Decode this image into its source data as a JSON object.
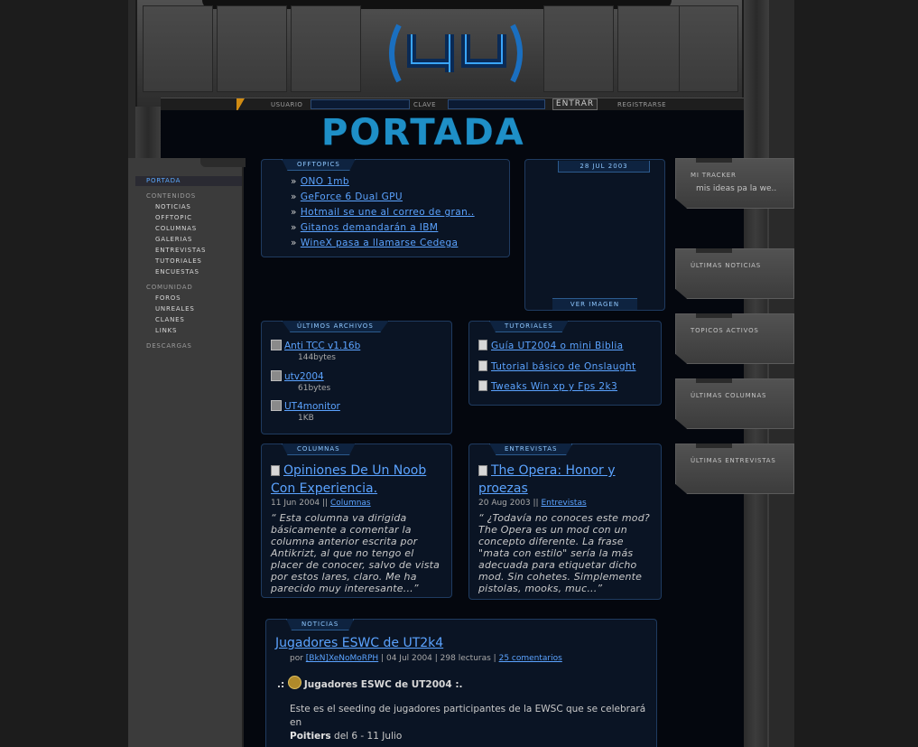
{
  "header": {
    "logo_text": "(4U)",
    "login": {
      "user_label": "USUARIO",
      "pass_label": "CLAVE",
      "enter_label": "ENTRAR",
      "register_label": "REGISTRARSE"
    }
  },
  "page_title": "PORTADA",
  "nav": {
    "portada": "PORTADA",
    "contenidos": "CONTENIDOS",
    "noticias": "NOTICIAS",
    "offtopic": "OFFTOPIC",
    "columnas": "COLUMNAS",
    "galerias": "GALERIAS",
    "entrevistas": "ENTREVISTAS",
    "tutoriales": "TUTORIALES",
    "encuestas": "ENCUESTAS",
    "comunidad": "COMUNIDAD",
    "foros": "FOROS",
    "unreales": "UNREALES",
    "clanes": "CLANES",
    "links": "LINKS",
    "descargas": "DESCARGAS"
  },
  "right": {
    "tracker_title": "Mi TRACKER",
    "tracker_text": "mis ideas pa la we..",
    "noticias": "ÚLTIMAS NOTICIAS",
    "topicos": "TOPICOS ACTIVOS",
    "columnas": "ÚLTIMAS COLUMNAS",
    "entrevistas": "ÚLTIMAS ENTREVISTAS"
  },
  "offtopics": {
    "title": "OFFTOPICS",
    "items": [
      "ONO 1mb",
      "GeForce 6 Dual GPU",
      "Hotmail se une al correo de gran..",
      "Gitanos demandarán a IBM",
      "WineX pasa a llamarse Cedega"
    ]
  },
  "image_box": {
    "date": "28 JUL 2003",
    "link": "VER IMAGEN"
  },
  "archivos": {
    "title": "ÚLTIMOS ARCHIVOS",
    "items": [
      {
        "name": "Anti TCC v1.16b",
        "size": "144bytes"
      },
      {
        "name": "utv2004",
        "size": "61bytes"
      },
      {
        "name": "UT4monitor",
        "size": "1KB"
      }
    ]
  },
  "tutoriales": {
    "title": "TUTORIALES",
    "items": [
      "Guía UT2004 o mini Biblia",
      "Tutorial básico de Onslaught",
      "Tweaks Win xp y Fps 2k3"
    ]
  },
  "columnas": {
    "title": "COLUMNAS",
    "heading": "Opiniones De Un Noob Con Experiencia.",
    "date": "11 Jun 2004 ||",
    "section": "Columnas",
    "quote": "“ Esta columna va dirigida básicamente a comentar la columna anterior escrita por Antikrizt, al que no tengo el placer de conocer, salvo de vista por estos lares, claro. Me ha parecido muy interesante...”"
  },
  "entrevistas": {
    "title": "ENTREVISTAS",
    "heading": "The Opera: Honor y proezas",
    "date": "20 Aug 2003 ||",
    "section": "Entrevistas",
    "quote": "“ ¿Todavía no conoces este mod? The Opera es un mod con un concepto diferente. La frase \"mata con estilo\" sería la más adecuada para etiquetar dicho mod. Sin cohetes. Simplemente pistolas, mooks, muc...”"
  },
  "noticias": {
    "title": "NOTICIAS",
    "heading": "Jugadores ESWC de UT2k4",
    "by": "por",
    "author": "[BkN]XeNoMoRPH",
    "meta": "| 04 Jul 2004 | 298 lecturas |",
    "comments": "25 comentarios",
    "subtitle_pre": ".:",
    "subtitle": "Jugadores ESWC de UT2004 :.",
    "body": "Este es el seeding de jugadores participantes de la EWSC que se celebrará en",
    "place": "Poitiers",
    "dates": "del 6 - 11 Julio"
  }
}
